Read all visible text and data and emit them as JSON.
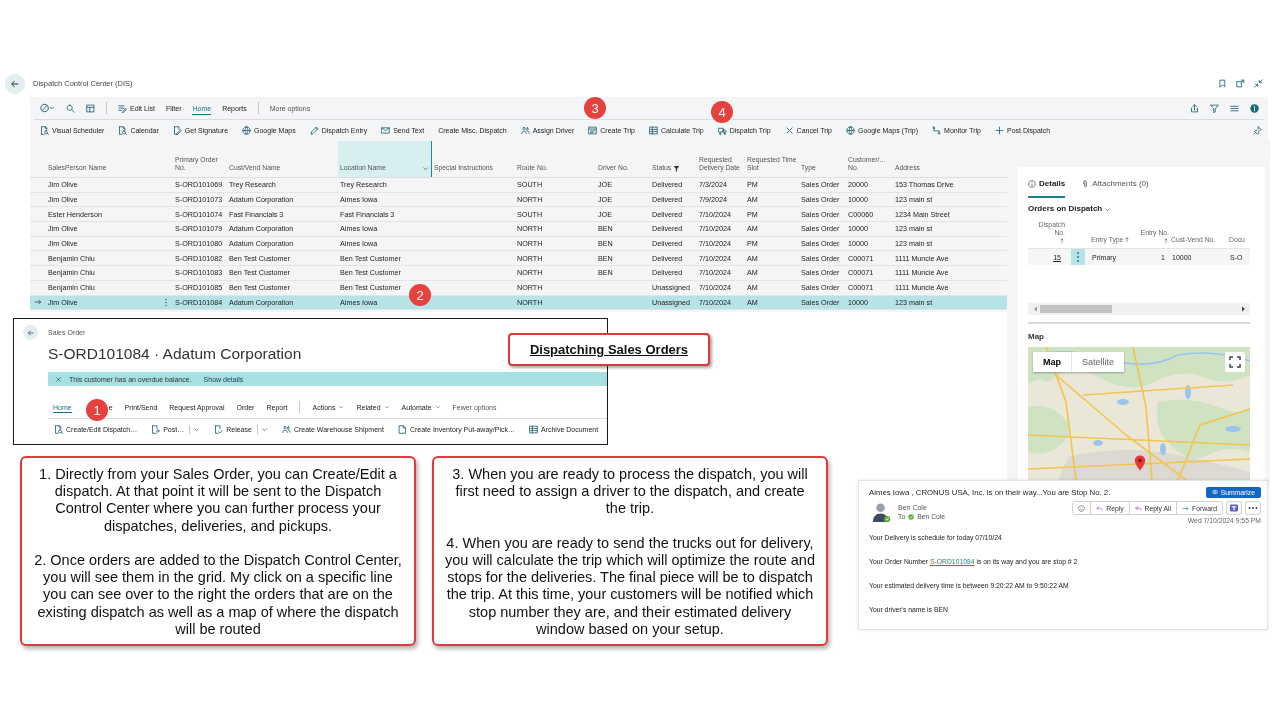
{
  "window": {
    "title": "Dispatch Control Center (DIS)"
  },
  "menu_bar": {
    "edit_list": "Edit List",
    "tabs": [
      {
        "label": "Filter",
        "selected": false
      },
      {
        "label": "Home",
        "selected": true
      },
      {
        "label": "Reports",
        "selected": false
      }
    ],
    "more_options": "More options"
  },
  "actions": [
    "Visual Scheduler",
    "Calendar",
    "Get Signature",
    "Google Maps",
    "Dispatch Entry",
    "Send Text",
    "Create Misc. Dispatch",
    "Assign Driver",
    "Create Trip",
    "Calculate Trip",
    "Dispatch Trip",
    "Cancel Trip",
    "Google Maps (Trip)",
    "Monitor Trip",
    "Post Dispatch"
  ],
  "table": {
    "columns": [
      {
        "label": "SalesPerson Name",
        "selected": false,
        "filtered": false
      },
      {
        "label": "Primary Order No.",
        "selected": false,
        "filtered": false
      },
      {
        "label": "Cust/Vend Name",
        "selected": false,
        "filtered": false
      },
      {
        "label": "Location Name",
        "selected": true,
        "filtered": false
      },
      {
        "label": "Special Instructions",
        "selected": false,
        "filtered": false
      },
      {
        "label": "Route No.",
        "selected": false,
        "filtered": false
      },
      {
        "label": "Driver No.",
        "selected": false,
        "filtered": false
      },
      {
        "label": "Status",
        "selected": false,
        "filtered": true
      },
      {
        "label": "Requested Delivery Date",
        "selected": false,
        "filtered": false
      },
      {
        "label": "Requested Time Slot",
        "selected": false,
        "filtered": false
      },
      {
        "label": "Type",
        "selected": false,
        "filtered": false
      },
      {
        "label": "Customer/… No.",
        "selected": false,
        "filtered": false
      },
      {
        "label": "Address",
        "selected": false,
        "filtered": false
      }
    ],
    "rows": [
      {
        "selected": false,
        "salesperson": "Jim Olive",
        "order_no": "S-ORD101069",
        "cust_vend_name": "Trey Research",
        "location_name": "Trey Research",
        "route_no": "SOUTH",
        "driver_no": "JOE",
        "status": "Delivered",
        "delivery_date": "7/3/2024",
        "time_slot": "PM",
        "type": "Sales Order",
        "customer_no": "20000",
        "address": "153 Thomas Drive"
      },
      {
        "selected": false,
        "salesperson": "Jim Olive",
        "order_no": "S-ORD101073",
        "cust_vend_name": "Adatum Corporation",
        "location_name": "Aimes Iowa",
        "route_no": "NORTH",
        "driver_no": "JOE",
        "status": "Delivered",
        "delivery_date": "7/9/2024",
        "time_slot": "AM",
        "type": "Sales Order",
        "customer_no": "10000",
        "address": "123 main st"
      },
      {
        "selected": false,
        "salesperson": "Ester Henderson",
        "order_no": "S-ORD101074",
        "cust_vend_name": "Fast Financials 3",
        "location_name": "Fast Financials 3",
        "route_no": "SOUTH",
        "driver_no": "JOE",
        "status": "Delivered",
        "delivery_date": "7/10/2024",
        "time_slot": "PM",
        "type": "Sales Order",
        "customer_no": "C00060",
        "address": "1234 Main Street"
      },
      {
        "selected": false,
        "salesperson": "Jim Olive",
        "order_no": "S-ORD101079",
        "cust_vend_name": "Adatum Corporation",
        "location_name": "Aimes Iowa",
        "route_no": "NORTH",
        "driver_no": "BEN",
        "status": "Delivered",
        "delivery_date": "7/10/2024",
        "time_slot": "AM",
        "type": "Sales Order",
        "customer_no": "10000",
        "address": "123 main st"
      },
      {
        "selected": false,
        "salesperson": "Jim Olive",
        "order_no": "S-ORD101080",
        "cust_vend_name": "Adatum Corporation",
        "location_name": "Aimes Iowa",
        "route_no": "NORTH",
        "driver_no": "BEN",
        "status": "Delivered",
        "delivery_date": "7/10/2024",
        "time_slot": "PM",
        "type": "Sales Order",
        "customer_no": "10000",
        "address": "123 main st"
      },
      {
        "selected": false,
        "salesperson": "Benjamin Chiu",
        "order_no": "S-ORD101082",
        "cust_vend_name": "Ben Test Customer",
        "location_name": "Ben Test Customer",
        "route_no": "NORTH",
        "driver_no": "BEN",
        "status": "Delivered",
        "delivery_date": "7/10/2024",
        "time_slot": "AM",
        "type": "Sales Order",
        "customer_no": "C00071",
        "address": "1111 Muncie Ave"
      },
      {
        "selected": false,
        "salesperson": "Benjamin Chiu",
        "order_no": "S-ORD101083",
        "cust_vend_name": "Ben Test Customer",
        "location_name": "Ben Test Customer",
        "route_no": "NORTH",
        "driver_no": "BEN",
        "status": "Delivered",
        "delivery_date": "7/10/2024",
        "time_slot": "AM",
        "type": "Sales Order",
        "customer_no": "C00071",
        "address": "1111 Muncie Ave"
      },
      {
        "selected": false,
        "salesperson": "Benjamin Chiu",
        "order_no": "S-ORD101085",
        "cust_vend_name": "Ben Test Customer",
        "location_name": "Ben Test Customer",
        "route_no": "NORTH",
        "status": "Unassigned",
        "delivery_date": "7/10/2024",
        "time_slot": "AM",
        "type": "Sales Order",
        "customer_no": "C00071",
        "address": "1111 Muncie Ave"
      },
      {
        "selected": true,
        "salesperson": "Jim Olive",
        "order_no": "S-ORD101084",
        "cust_vend_name": "Adatum Corporation",
        "location_name": "Aimes Iowa",
        "route_no": "NORTH",
        "status": "Unassigned",
        "delivery_date": "7/10/2024",
        "time_slot": "AM",
        "type": "Sales Order",
        "customer_no": "10000",
        "address": "123 main st"
      }
    ]
  },
  "factbox": {
    "tabs": [
      {
        "label": "Details",
        "selected": true
      },
      {
        "label": "Attachments (0)",
        "selected": false
      }
    ],
    "section": "Orders on Dispatch",
    "columns": [
      {
        "label": "Dispatch No.",
        "sorted": true
      },
      {
        "label": "Entry Type",
        "sorted": true
      },
      {
        "label": "Entry No.",
        "sorted": true
      },
      {
        "label": "Cust-Vend No.",
        "sorted": false
      },
      {
        "label": "Docu",
        "sorted": false
      }
    ],
    "rows": [
      {
        "cells": [
          "15",
          "Primary",
          "1",
          "10000",
          "S-O"
        ]
      }
    ],
    "map": {
      "title": "Map",
      "types": [
        {
          "label": "Map",
          "selected": true
        },
        {
          "label": "Satellite",
          "selected": false
        }
      ]
    }
  },
  "sales_order": {
    "breadcrumb": "Sales Order",
    "title": "S-ORD101084 · Adatum Corporation",
    "notification": {
      "message": "This customer has an overdue balance.",
      "link": "Show details"
    },
    "tabs": [
      {
        "label": "Home",
        "selected": true
      },
      {
        "label": "e",
        "selected": false
      },
      {
        "label": "Print/Send",
        "selected": false
      },
      {
        "label": "Request Approval",
        "selected": false
      },
      {
        "label": "Order",
        "selected": false
      },
      {
        "label": "Report",
        "selected": false
      }
    ],
    "menus": [
      "Actions",
      "Related",
      "Automate"
    ],
    "fewer_options": "Fewer options",
    "actions": [
      {
        "label": "Create/Edit Dispatch…",
        "split": false
      },
      {
        "label": "Post…",
        "split": true
      },
      {
        "label": "Release",
        "split": true
      },
      {
        "label": "Create Warehouse Shipment",
        "split": false
      },
      {
        "label": "Create Inventory Put-away/Pick…",
        "split": false
      },
      {
        "label": "Archive Document",
        "split": false
      }
    ]
  },
  "callout": "Dispatching Sales Orders",
  "step_markers": [
    "1",
    "2",
    "3",
    "4"
  ],
  "notes": [
    {
      "paragraphs": [
        "1. Directly from your Sales Order, you can Create/Edit a dispatch. At that point it will be sent to the Dispatch Control Center where you can further process your dispatches, deliveries, and pickups.",
        "2. Once orders are added to the Dispatch Control Center, you will see them in the grid. My click on a specific line you can see over to the right the orders that are on the existing dispatch as well as a map of where the dispatch will be routed"
      ]
    },
    {
      "paragraphs": [
        "3. When you are ready to process the dispatch, you will first need to assign a driver to the dispatch, and create the trip.",
        "4. When you are ready to send the trucks out for delivery, you will calculate the trip which will optimize the route and stops for the deliveries. The final piece will be to dispatch the trip. At this time, your customers will be notified which stop number they are, and their estimated delivery window based on your setup."
      ]
    }
  ],
  "email": {
    "subject": "Aimes Iowa , CRONUS USA, Inc. is on their way...You are Stop No. 2.",
    "summarize": "Summarize",
    "sender": "Ben Cole",
    "to_label": "To",
    "recipient": "Ben Cole",
    "actions": [
      "Reply",
      "Reply All",
      "Forward"
    ],
    "date": "Wed 7/10/2024 9:55 PM",
    "body": [
      {
        "text": "Your Delivery is schedule for today 07/10/24"
      },
      {
        "text": "Your Order Number",
        "link": "S-ORD101084",
        "after": "is on its way and you are stop # 2"
      },
      {
        "text": "Your estimated delivery time is between 9:20:22 AM to 9:50:22 AM"
      },
      {
        "text": "Your driver's name is BEN"
      }
    ]
  }
}
